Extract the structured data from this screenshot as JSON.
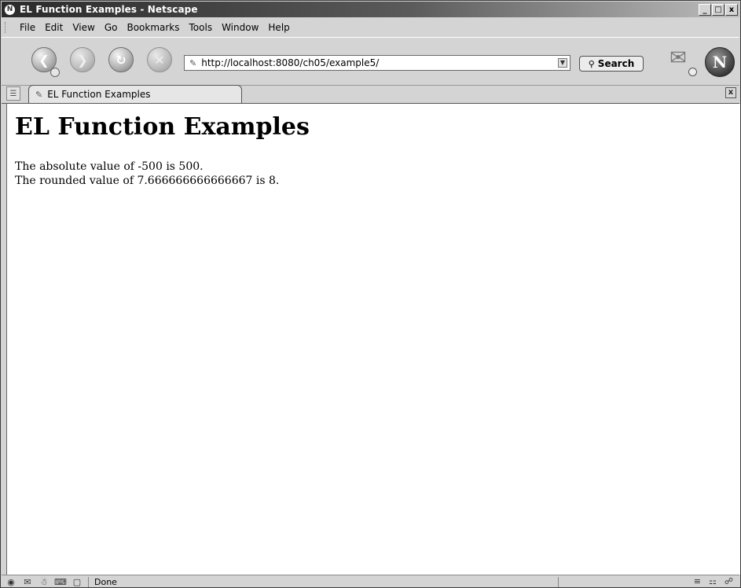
{
  "window": {
    "title": "EL Function Examples - Netscape",
    "controls": [
      "_",
      "□",
      "x"
    ]
  },
  "menu": {
    "items": [
      "File",
      "Edit",
      "View",
      "Go",
      "Bookmarks",
      "Tools",
      "Window",
      "Help"
    ]
  },
  "toolbar": {
    "url": "http://localhost:8080/ch05/example5/",
    "search_label": "Search",
    "logo_letter": "N"
  },
  "tabs": [
    {
      "label": "EL Function Examples"
    }
  ],
  "page": {
    "heading": "EL Function Examples",
    "lines": [
      "The absolute value of -500 is 500.",
      "The rounded value of 7.666666666666667 is 8."
    ]
  },
  "status": {
    "text": "Done"
  },
  "colors": {
    "chrome": "#d4d4d4",
    "content_bg": "#ffffff"
  }
}
